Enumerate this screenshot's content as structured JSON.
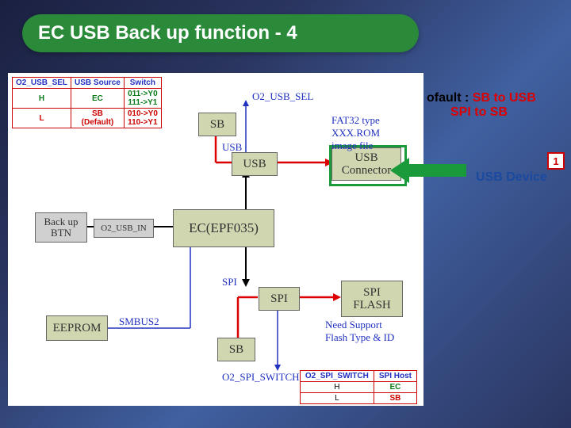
{
  "title": "EC USB Back up function - 4",
  "boxes": {
    "sb_top": "SB",
    "usb": "USB",
    "usb_conn": "USB\nConnector",
    "backup_btn": "Back up\nBTN",
    "o2_usb_in": "O2_USB_IN",
    "ec": "EC(EPF035)",
    "eeprom": "EEPROM",
    "sb_bot": "SB",
    "spi": "SPI",
    "spi_flash": "SPI\nFLASH"
  },
  "labels": {
    "o2_usb_sel": "O2_USB_SEL",
    "usb_vert": "USB",
    "fat32": "FAT32 type\nXXX.ROM\nimage file",
    "smbus2": "SMBUS2",
    "spi_vert": "SPI",
    "need_support": "Need Support\nFlash Type & ID",
    "o2_spi_switch": "O2_SPI_SWITCH"
  },
  "usb_table": {
    "headers": [
      "O2_USB_SEL",
      "USB Source",
      "Switch"
    ],
    "rows": [
      {
        "sel": "H",
        "src": "EC",
        "sw": "011->Y0\n111->Y1"
      },
      {
        "sel": "L",
        "src": "SB\n(Default)",
        "sw": "010->Y0\n110->Y1"
      }
    ]
  },
  "spi_table": {
    "headers": [
      "O2_SPI_SWITCH",
      "SPI Host"
    ],
    "rows": [
      {
        "sw": "H",
        "host": "EC"
      },
      {
        "sw": "L",
        "host": "SB"
      }
    ]
  },
  "side": {
    "default_prefix": "ofault : ",
    "default_red1": "SB to USB",
    "default_red2": "SPI to SB",
    "usb_device": "USB Device",
    "badge": "1"
  }
}
